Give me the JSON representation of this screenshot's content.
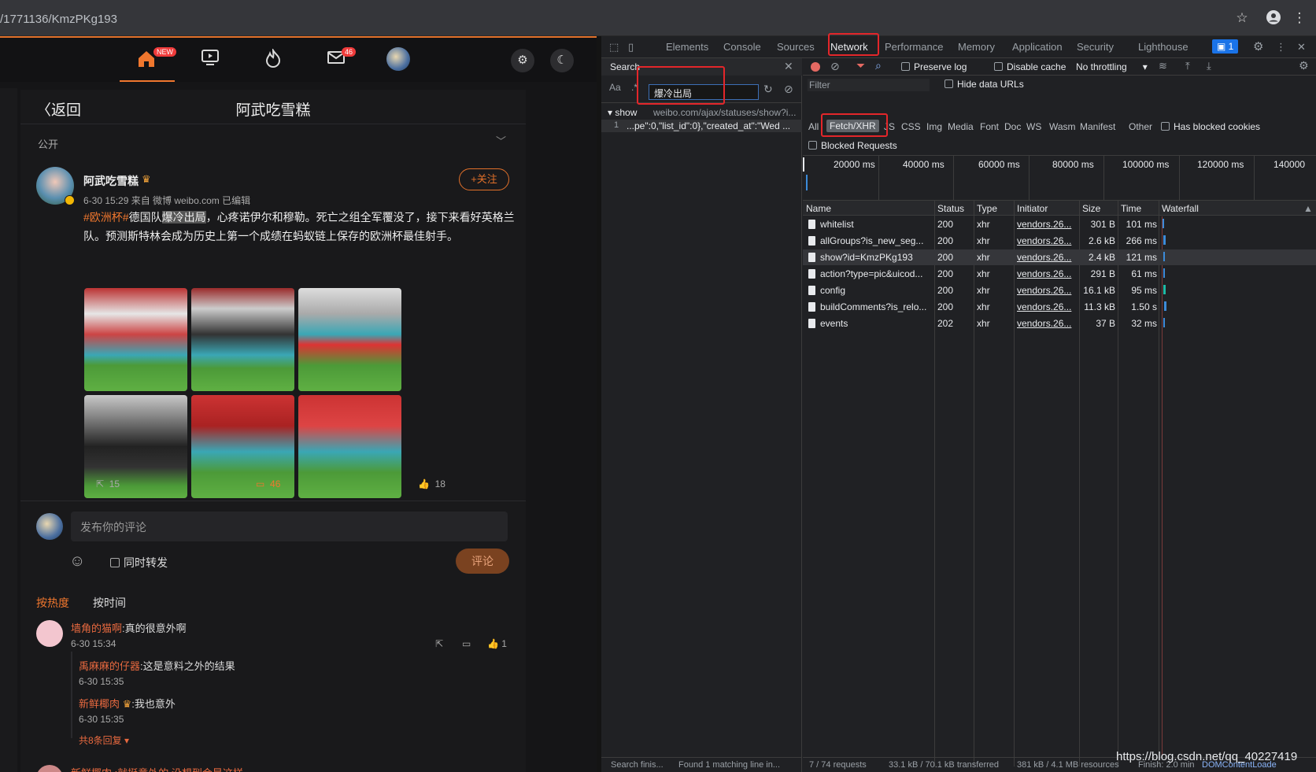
{
  "browser": {
    "url": "/1771136/KmzPKg193"
  },
  "nav": {
    "new_badge": "NEW",
    "mail_badge": "46"
  },
  "post": {
    "back_label": "返回",
    "page_title": "阿武吃雪糕",
    "visibility": "公开",
    "author": "阿武吃雪糕",
    "meta": "6-30 15:29 来自 微博 weibo.com 已编辑",
    "follow_label": "+关注",
    "hashtag": "#欧洲杯#",
    "text_pre": "德国队",
    "highlight": "爆冷出局",
    "text_post": "，心疼诺伊尔和穆勒。死亡之组全军覆没了，接下来看好英格兰队。预测斯特林会成为历史上第一个成绩在蚂蚁链上保存的欧洲杯最佳射手。",
    "reposts": "15",
    "comments": "46",
    "likes": "18"
  },
  "composer": {
    "placeholder": "发布你的评论",
    "repost_label": "同时转发",
    "submit_label": "评论"
  },
  "sort": {
    "hot": "按热度",
    "time": "按时间"
  },
  "comments": {
    "c1_user": "墙角的猫啊",
    "c1_text": ":真的很意外啊",
    "c1_time": "6-30 15:34",
    "c1_likes": "1",
    "r1_user": "禹麻麻的仔器",
    "r1_text": ":这是意料之外的结果",
    "r1_time": "6-30 15:35",
    "r2_user": "新鲜椰肉",
    "r2_text": ":我也意外",
    "r2_time": "6-30 15:35",
    "more_replies": "共8条回复",
    "c2_partial": "新鲜椰肉 :就挺意外的 没想到会是这样"
  },
  "devtools": {
    "tabs": [
      "Elements",
      "Console",
      "Sources",
      "Network",
      "Performance",
      "Memory",
      "Application",
      "Security",
      "Lighthouse"
    ],
    "issues_count": "1",
    "search_title": "Search",
    "search_case": "Aa",
    "search_regex": ".*",
    "search_query": "爆冷出局",
    "result_file": "show",
    "result_url": "weibo.com/ajax/statuses/show?i...",
    "result_line_no": "1",
    "result_line": "...pe\":0,\"list_id\":0},\"created_at\":\"Wed ...",
    "search_status_left": "Search finis...",
    "search_status_right": "Found 1 matching line in...",
    "preserve_log": "Preserve log",
    "disable_cache": "Disable cache",
    "throttling": "No throttling",
    "filter_placeholder": "Filter",
    "hide_data_urls": "Hide data URLs",
    "filter_types": [
      "All",
      "Fetch/XHR",
      "JS",
      "CSS",
      "Img",
      "Media",
      "Font",
      "Doc",
      "WS",
      "Wasm",
      "Manifest",
      "Other"
    ],
    "has_blocked_cookies": "Has blocked cookies",
    "blocked_requests": "Blocked Requests",
    "timeline_ticks": [
      "20000 ms",
      "40000 ms",
      "60000 ms",
      "80000 ms",
      "100000 ms",
      "120000 ms",
      "140000"
    ],
    "columns": [
      "Name",
      "Status",
      "Type",
      "Initiator",
      "Size",
      "Time",
      "Waterfall"
    ],
    "requests": [
      {
        "name": "whitelist",
        "status": "200",
        "type": "xhr",
        "initiator": "vendors.26...",
        "size": "301 B",
        "time": "101 ms"
      },
      {
        "name": "allGroups?is_new_seg...",
        "status": "200",
        "type": "xhr",
        "initiator": "vendors.26...",
        "size": "2.6 kB",
        "time": "266 ms"
      },
      {
        "name": "show?id=KmzPKg193",
        "status": "200",
        "type": "xhr",
        "initiator": "vendors.26...",
        "size": "2.4 kB",
        "time": "121 ms"
      },
      {
        "name": "action?type=pic&uicod...",
        "status": "200",
        "type": "xhr",
        "initiator": "vendors.26...",
        "size": "291 B",
        "time": "61 ms"
      },
      {
        "name": "config",
        "status": "200",
        "type": "xhr",
        "initiator": "vendors.26...",
        "size": "16.1 kB",
        "time": "95 ms"
      },
      {
        "name": "buildComments?is_relo...",
        "status": "200",
        "type": "xhr",
        "initiator": "vendors.26...",
        "size": "11.3 kB",
        "time": "1.50 s"
      },
      {
        "name": "events",
        "status": "202",
        "type": "xhr",
        "initiator": "vendors.26...",
        "size": "37 B",
        "time": "32 ms"
      }
    ],
    "status_requests": "7 / 74 requests",
    "status_transferred": "33.1 kB / 70.1 kB transferred",
    "status_resources": "381 kB / 4.1 MB resources",
    "status_finish": "Finish: 2.0 min",
    "status_dcl": "DOMContentLoade"
  },
  "watermark": "https://blog.csdn.net/qq_40227419"
}
